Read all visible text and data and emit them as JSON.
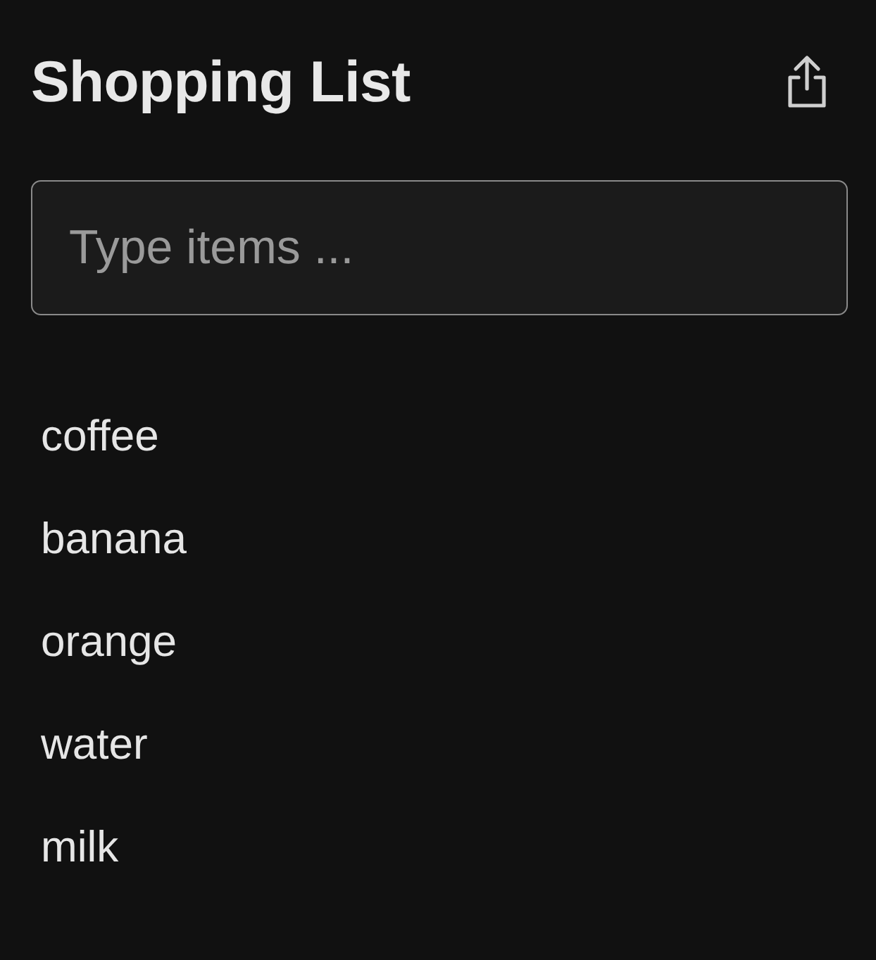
{
  "header": {
    "title": "Shopping List"
  },
  "input": {
    "placeholder": "Type items ..."
  },
  "items": [
    "coffee",
    "banana",
    "orange",
    "water",
    "milk"
  ]
}
